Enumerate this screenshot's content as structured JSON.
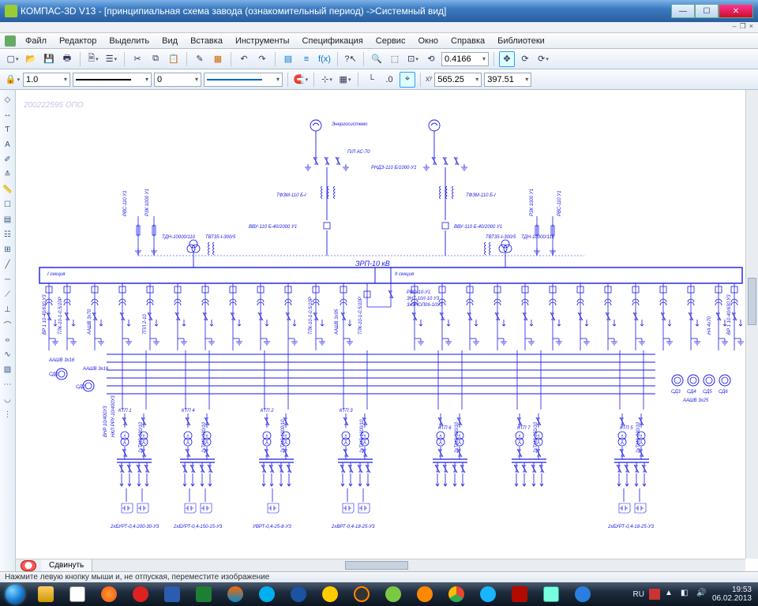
{
  "title": "КОМПАС-3D V13 - [принципиальная схема завода (ознакомительный период) ->Системный вид]",
  "menu": {
    "file": "Файл",
    "edit": "Редактор",
    "select": "Выделить",
    "view": "Вид",
    "insert": "Вставка",
    "tools": "Инструменты",
    "spec": "Спецификация",
    "service": "Сервис",
    "window": "Окно",
    "help": "Справка",
    "lib": "Библиотеки"
  },
  "zoom": "0.4166",
  "linewidth": "1.0",
  "style_index": "0",
  "coord_x": "565.25",
  "coord_y": "397.51",
  "tab": "Сдвинуть",
  "status": "Нажмите левую кнопку мыши и, не отпуская, переместите изображение",
  "tray": {
    "lang": "RU",
    "time": "19:53",
    "date": "06.02.2013"
  },
  "schem": {
    "watermark": "200222595 ОПО",
    "top_label": "Энергосистемо",
    "pl": "П/Л АС-70",
    "rndz": "РНДЗ-110 Б/1000-У1",
    "tfzm_l": "ТФЗМ-110 Б-I",
    "tfzm_r": "ТФЗМ-110 Б-I",
    "vvu_l": "ВВУ-110 Б-40/2000 У1",
    "vvu_r": "ВВУ-110 Б-40/2000 У1",
    "t1": "ТДН-10000/110",
    "t1a": "ТВТ35-I-300/5",
    "t2": "ТДН-10000/110",
    "t2a": "ТВТ35-I-300/5",
    "rvs_l": "РВС-110 У1",
    "rvs_l2": "РЗК 1000 У1",
    "rvs_r": "РВС-110 У1",
    "rvs_r2": "РЗК 1000 У1",
    "zrp": "ЗРП-10 кВ",
    "sec1": "I секция",
    "sec2": "II секция",
    "rvo": "РВО-10-У1",
    "zkt": "ЗНТ-10/I-10 У3",
    "txt_s": "3хЗНОЛ09-10У3",
    "feeder_v": [
      "ВР 1 10-40/630 У3",
      "ТЛК-10-1-0,5/10Р",
      "ААШВ 3x70",
      "ТПЛ 2-10",
      "ААШВ 3x95"
    ],
    "sd": [
      "СД1",
      "СД2",
      "СД3",
      "СД4",
      "СД5",
      "СД6"
    ],
    "aashv": "ААШВ 3x16",
    "aashv2": "ААШВ 3x16",
    "aashv3": "ААШВ 3x25",
    "ktp": [
      "КТП 1",
      "КТП 4",
      "КТП 2",
      "КТП 3",
      "КТП 6",
      "КТП 7",
      "КТП 5"
    ],
    "ktp_t": [
      "2хТМЗ-630/10",
      "2хТМЗ-630/10",
      "2хТМЗ-1000/10",
      "2хТМЗ-1600/10",
      "2хТМЗ-630/10",
      "2хТМЗ-250/10",
      "2хТМЗ-630/10"
    ],
    "ktp_side": [
      "ВНР 10/400У3",
      "НКЛ РРУ-10/400У3"
    ],
    "bsh": [
      "2хБУРТ-0,4-200-30-У3",
      "2хБУРТ-0,4-150-15-У3",
      "УВРТ-0,4-25-8-У3",
      "2хВРТ-0,4-18-25-У3",
      "2хБУРТ-0,4-18-25-У3"
    ],
    "na": "НА 4х70"
  }
}
